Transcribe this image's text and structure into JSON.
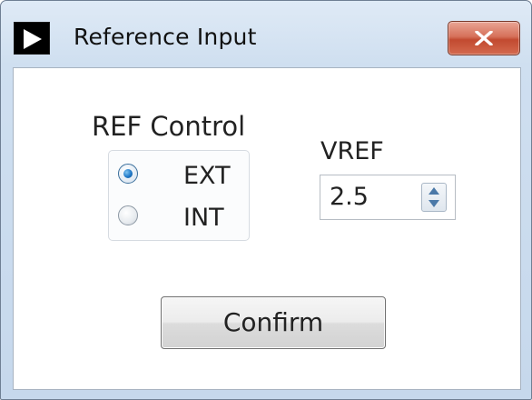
{
  "window": {
    "title": "Reference Input"
  },
  "titlebar": {
    "app_icon": "play-arrow-icon",
    "close_icon": "close-icon"
  },
  "ref_control": {
    "label": "REF Control",
    "options": [
      {
        "label": "EXT",
        "selected": true
      },
      {
        "label": "INT",
        "selected": false
      }
    ]
  },
  "vref": {
    "label": "VREF",
    "value": "2.5",
    "spin_icon": "spin-updown-icon"
  },
  "confirm": {
    "label": "Confirm"
  },
  "colors": {
    "close_button": "#c8533a",
    "radio_selected": "#1f78c8",
    "window_frame": "#cfdff0"
  }
}
